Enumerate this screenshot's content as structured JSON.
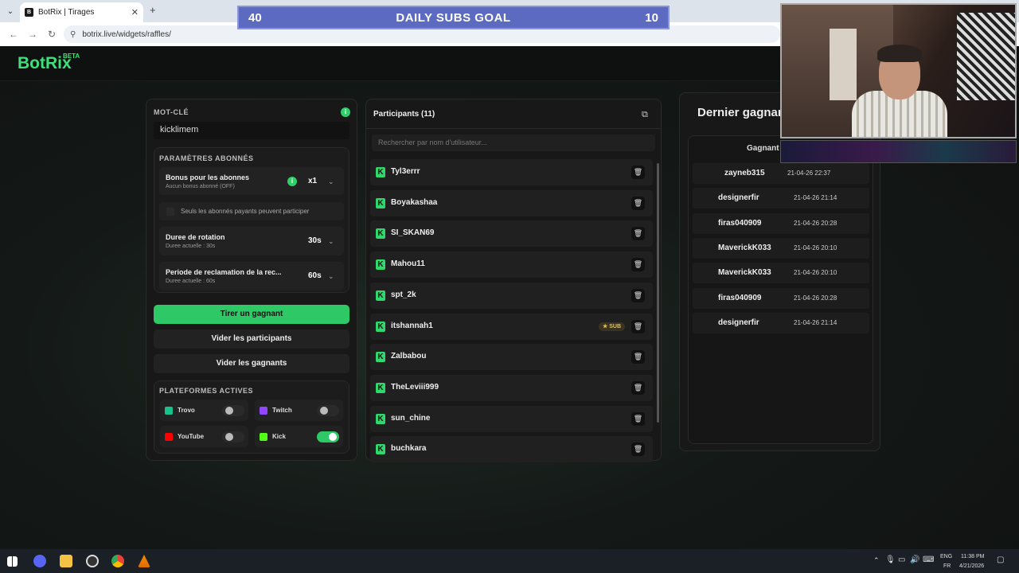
{
  "browser": {
    "tab_title": "BotRix | Tirages",
    "url": "botrix.live/widgets/raffles/"
  },
  "goal": {
    "left": "40",
    "title": "DAILY SUBS GOAL",
    "right": "10"
  },
  "app": {
    "logo": "BotRix",
    "beta": "BETA"
  },
  "settings": {
    "keyword_label": "MOT-CLÉ",
    "keyword_value": "kicklimem",
    "subs_section": "PARAMÈTRES ABONNÉS",
    "bonus_title": "Bonus pour les abonnes",
    "bonus_sub": "Aucun bonus abonné (OFF)",
    "bonus_value": "x1",
    "only_subs": "Seuls les abonnés payants peuvent participer",
    "rotation_title": "Duree de rotation",
    "rotation_sub": "Duree actuelle : 30s",
    "rotation_value": "30s",
    "claim_title": "Periode de reclamation de la rec...",
    "claim_sub": "Duree actuelle : 60s",
    "claim_value": "60s",
    "draw_button": "Tirer un gagnant",
    "clear_participants": "Vider les participants",
    "clear_winners": "Vider les gagnants",
    "platforms_section": "PLATEFORMES ACTIVES",
    "platforms": [
      {
        "name": "Trovo",
        "color": "#19c28b",
        "on": false
      },
      {
        "name": "Twitch",
        "color": "#9146ff",
        "on": false
      },
      {
        "name": "YouTube",
        "color": "#ff0000",
        "on": false
      },
      {
        "name": "Kick",
        "color": "#53fc18",
        "on": true
      }
    ]
  },
  "participants": {
    "title": "Participants (11)",
    "search_placeholder": "Rechercher par nom d'utilisateur...",
    "sub_badge": "SUB",
    "list": [
      "Tyl3errr",
      "Boyakashaa",
      "SI_SKAN69",
      "Mahou11",
      "spt_2k",
      "itshannah1",
      "Zalbabou",
      "TheLeviii999",
      "sun_chine",
      "buchkara"
    ]
  },
  "winners": {
    "title": "Dernier gagnan",
    "column": "Gagnant",
    "list": [
      {
        "name": "zayneb315",
        "date": "21-04-26 22:37"
      },
      {
        "name": "designerfir",
        "date": "21-04-26 21:14"
      },
      {
        "name": "firas040909",
        "date": "21-04-26 20:28"
      },
      {
        "name": "MaverickK033",
        "date": "21-04-26 20:10"
      },
      {
        "name": "MaverickK033",
        "date": "21-04-26 20:10"
      },
      {
        "name": "firas040909",
        "date": "21-04-26 20:28"
      },
      {
        "name": "designerfir",
        "date": "21-04-26 21:14"
      }
    ]
  },
  "taskbar": {
    "lang1": "ENG",
    "lang2": "FR",
    "time": "11:38 PM",
    "date": "4/21/2026"
  }
}
